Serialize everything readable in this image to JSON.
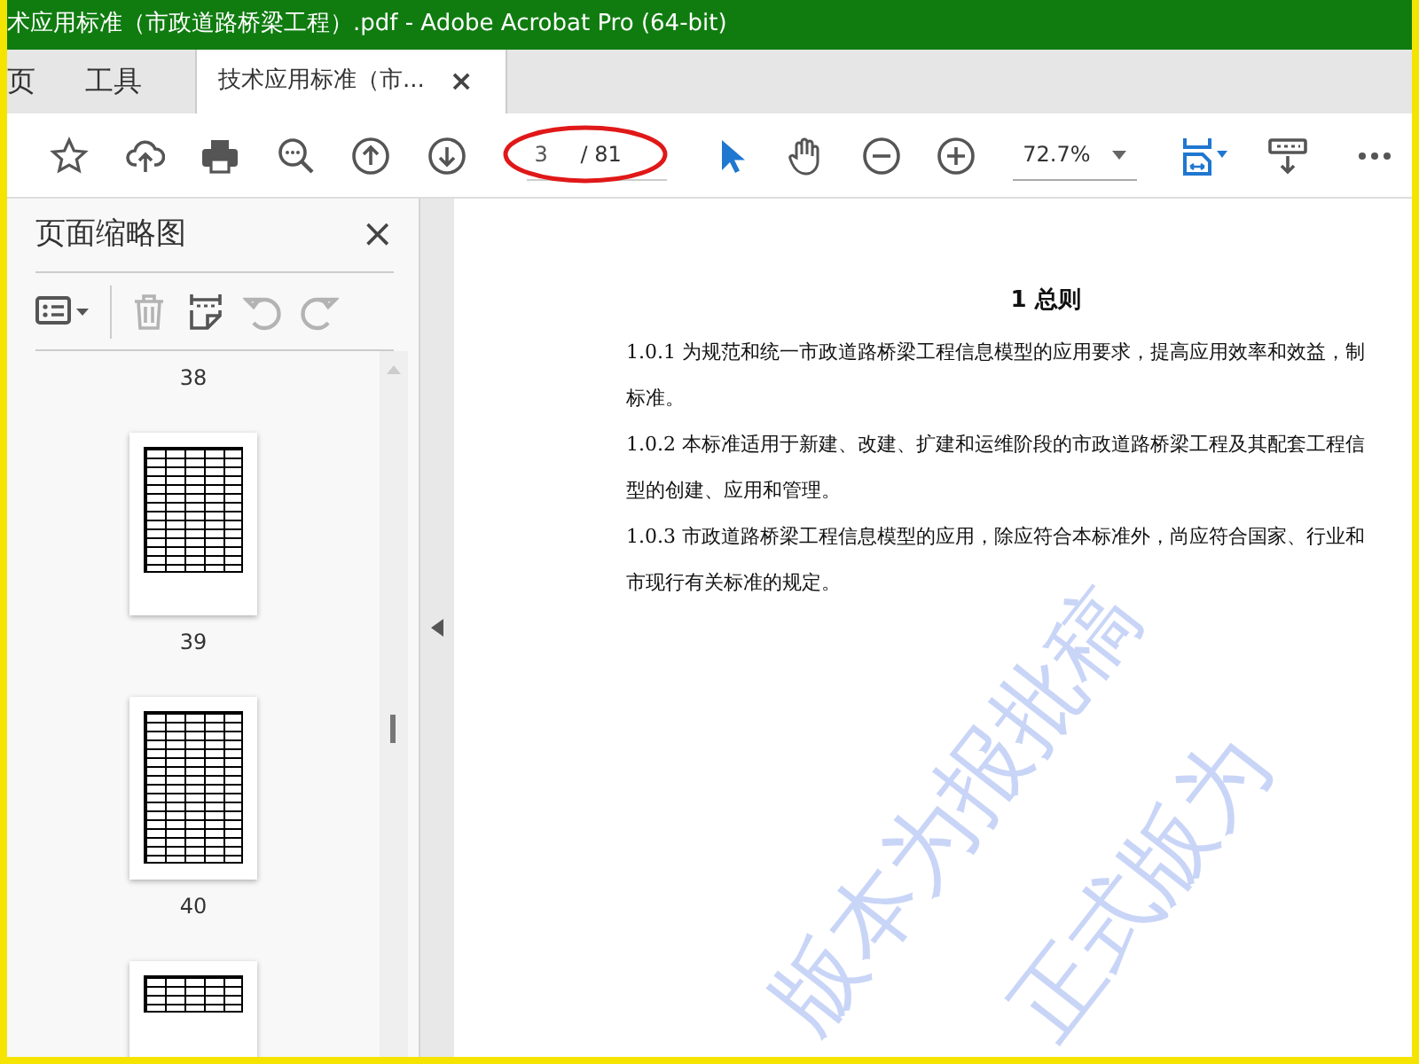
{
  "window": {
    "title": "术应用标准（市政道路桥梁工程）.pdf - Adobe Acrobat Pro (64-bit)"
  },
  "tabs": [
    {
      "label": "页",
      "selected": false
    },
    {
      "label": "工具",
      "selected": false
    },
    {
      "label": "技术应用标准（市...",
      "selected": true,
      "close": "×"
    }
  ],
  "toolbar": {
    "page_field": {
      "value": "3",
      "total": "/ 81"
    },
    "zoom_field": {
      "value": "72.7%"
    }
  },
  "thumbnail_pane": {
    "title": "页面缩略图",
    "close": "×",
    "tools": [
      {
        "kind": "options",
        "disabled": false
      },
      {
        "kind": "delete",
        "disabled": true
      },
      {
        "kind": "insert",
        "disabled": false
      },
      {
        "kind": "rotate-left",
        "disabled": true
      },
      {
        "kind": "rotate-right",
        "disabled": true
      }
    ],
    "pages": [
      {
        "label": "38"
      },
      {
        "label": "39"
      },
      {
        "label": "40"
      }
    ]
  },
  "document": {
    "heading": "1  总则",
    "lines": [
      "1.0.1  为规范和统一市政道路桥梁工程信息模型的应用要求，提高应用效率和效益，制",
      "标准。",
      "1.0.2  本标准适用于新建、改建、扩建和运维阶段的市政道路桥梁工程及其配套工程信",
      "型的创建、应用和管理。",
      "1.0.3    市政道路桥梁工程信息模型的应用，除应符合本标准外，尚应符合国家、行业和",
      "市现行有关标准的规定。"
    ],
    "draft_watermark": [
      "版本为报批稿",
      "正式版为"
    ]
  }
}
